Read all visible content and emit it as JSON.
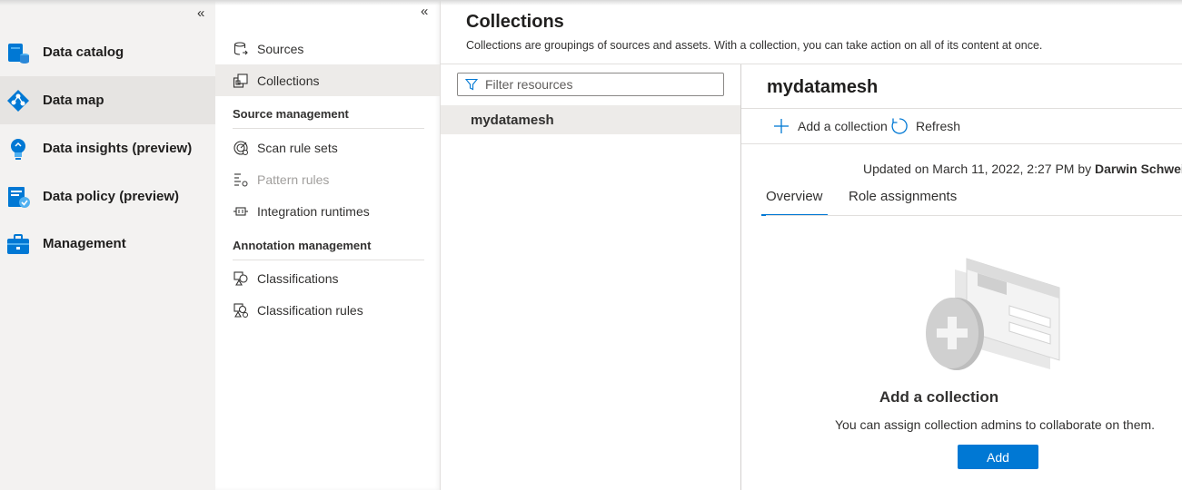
{
  "leftnav": {
    "items": [
      {
        "label": "Data catalog",
        "icon": "data-catalog-icon"
      },
      {
        "label": "Data map",
        "icon": "data-map-icon",
        "active": true
      },
      {
        "label": "Data insights (preview)",
        "icon": "data-insights-icon"
      },
      {
        "label": "Data policy (preview)",
        "icon": "data-policy-icon"
      },
      {
        "label": "Management",
        "icon": "management-icon"
      }
    ],
    "collapse_glyph": "«"
  },
  "subnav": {
    "collapse_glyph": "«",
    "items": [
      {
        "label": "Sources",
        "icon": "sources-icon"
      },
      {
        "label": "Collections",
        "icon": "collections-icon",
        "active": true
      }
    ],
    "source_management": {
      "header": "Source management",
      "items": [
        {
          "label": "Scan rule sets",
          "icon": "scan-rule-sets-icon"
        },
        {
          "label": "Pattern rules",
          "icon": "pattern-rules-icon",
          "disabled": true
        },
        {
          "label": "Integration runtimes",
          "icon": "integration-runtimes-icon"
        }
      ]
    },
    "annotation_management": {
      "header": "Annotation management",
      "items": [
        {
          "label": "Classifications",
          "icon": "classifications-icon"
        },
        {
          "label": "Classification rules",
          "icon": "classification-rules-icon"
        }
      ]
    }
  },
  "main": {
    "title": "Collections",
    "description": "Collections are groupings of sources and assets. With a collection, you can take action on all of its content at once.",
    "filter_placeholder": "Filter resources",
    "collections": [
      {
        "name": "mydatamesh",
        "selected": true
      }
    ]
  },
  "detail": {
    "title": "mydatamesh",
    "commands": {
      "add_collection": "Add a collection",
      "refresh": "Refresh"
    },
    "updated_prefix": "Updated on March 11, 2022, 2:27 PM by",
    "updated_by": "Darwin Schweitzer",
    "tabs": [
      {
        "label": "Overview",
        "active": true
      },
      {
        "label": "Role assignments"
      }
    ],
    "empty": {
      "title": "Add a collection",
      "description": "You can assign collection admins to collaborate on them.",
      "button": "Add"
    }
  },
  "colors": {
    "accent": "#0078d4",
    "nav_bg": "#f3f2f1",
    "selected_bg": "#edebe9"
  }
}
